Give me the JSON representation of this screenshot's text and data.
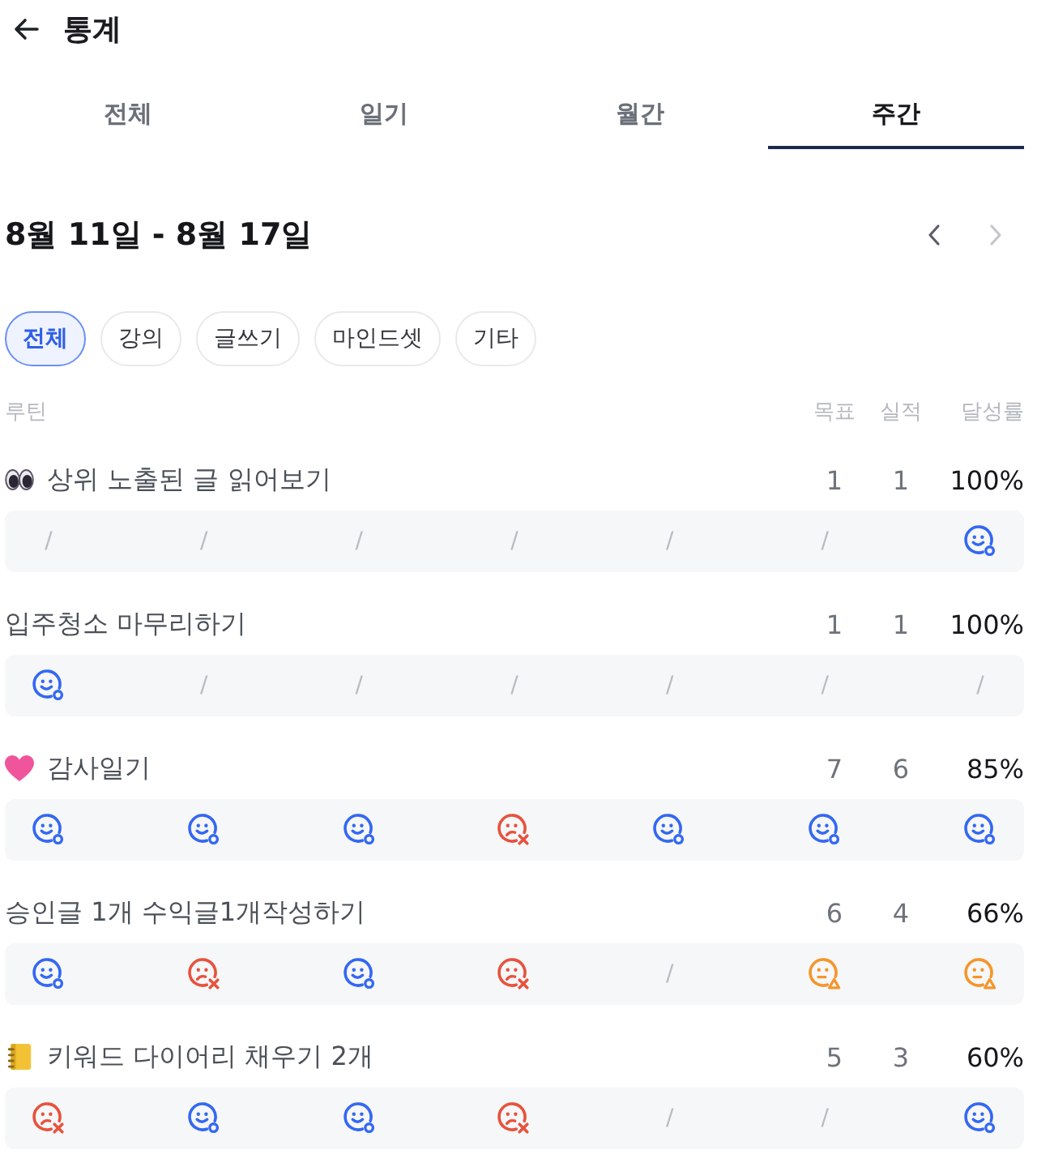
{
  "header": {
    "title": "통계"
  },
  "tabs": [
    {
      "label": "전체",
      "selected": false
    },
    {
      "label": "일기",
      "selected": false
    },
    {
      "label": "월간",
      "selected": false
    },
    {
      "label": "주간",
      "selected": true
    }
  ],
  "week": {
    "range": "8월 11일 - 8월 17일",
    "prev_disabled": false,
    "next_disabled": true
  },
  "filters": [
    {
      "label": "전체",
      "selected": true
    },
    {
      "label": "강의",
      "selected": false
    },
    {
      "label": "글쓰기",
      "selected": false
    },
    {
      "label": "마인드셋",
      "selected": false
    },
    {
      "label": "기타",
      "selected": false
    }
  ],
  "table": {
    "columns": [
      "루틴",
      "목표",
      "실적",
      "달성률"
    ],
    "rows": [
      {
        "name": "상위 노출된 글 읽어보기",
        "target": "1",
        "actual": "1",
        "rate": "100%",
        "days": [
          {
            "kind": "blank",
            "text": "/"
          },
          {
            "kind": "blank",
            "text": "/"
          },
          {
            "kind": "blank",
            "text": "/"
          },
          {
            "kind": "blank",
            "text": "/"
          },
          {
            "kind": "blank",
            "text": "/"
          },
          {
            "kind": "blank",
            "text": "/"
          },
          {
            "kind": "done"
          }
        ]
      },
      {
        "name": "입주청소 마무리하기",
        "target": "1",
        "actual": "1",
        "rate": "100%",
        "days": [
          {
            "kind": "done"
          },
          {
            "kind": "blank",
            "text": "/"
          },
          {
            "kind": "blank",
            "text": "/"
          },
          {
            "kind": "blank",
            "text": "/"
          },
          {
            "kind": "blank",
            "text": "/"
          },
          {
            "kind": "blank",
            "text": "/"
          },
          {
            "kind": "blank",
            "text": "/"
          }
        ]
      },
      {
        "name": "감사일기",
        "target": "7",
        "actual": "6",
        "rate": "85%",
        "days": [
          {
            "kind": "done"
          },
          {
            "kind": "done"
          },
          {
            "kind": "done"
          },
          {
            "kind": "missed"
          },
          {
            "kind": "done"
          },
          {
            "kind": "done"
          },
          {
            "kind": "done"
          }
        ]
      },
      {
        "name": "승인글 1개 수익글1개작성하기",
        "target": "6",
        "actual": "4",
        "rate": "66%",
        "days": [
          {
            "kind": "done"
          },
          {
            "kind": "missed"
          },
          {
            "kind": "done"
          },
          {
            "kind": "missed"
          },
          {
            "kind": "blank",
            "text": "/"
          },
          {
            "kind": "partial"
          },
          {
            "kind": "partial"
          }
        ]
      },
      {
        "name": "키워드 다이어리 채우기 2개",
        "target": "5",
        "actual": "3",
        "rate": "60%",
        "days": [
          {
            "kind": "missed"
          },
          {
            "kind": "done"
          },
          {
            "kind": "done"
          },
          {
            "kind": "missed"
          },
          {
            "kind": "blank",
            "text": "/"
          },
          {
            "kind": "blank",
            "text": "/"
          },
          {
            "kind": "done"
          }
        ]
      }
    ]
  }
}
